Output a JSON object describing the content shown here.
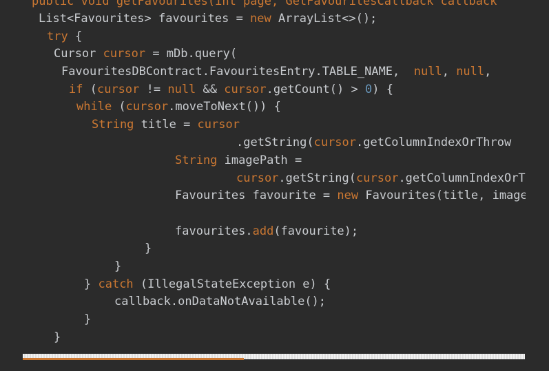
{
  "editor": {
    "lines": [
      [
        {
          "t": "public void getFavourites(int page, GetFavouritesCallback callback",
          "c": "partial"
        }
      ],
      [
        {
          "t": "List<Favourites> favourites = ",
          "c": "tok-plain"
        },
        {
          "t": "new",
          "c": "tok-kw"
        },
        {
          "t": " ArrayList<>();",
          "c": "tok-plain"
        }
      ],
      [
        {
          "t": "try",
          "c": "tok-kw"
        },
        {
          "t": " {",
          "c": "tok-plain"
        }
      ],
      [
        {
          "t": "Cursor ",
          "c": "tok-plain"
        },
        {
          "t": "cursor",
          "c": "tok-orange"
        },
        {
          "t": " = mDb.query(",
          "c": "tok-plain"
        }
      ],
      [
        {
          "t": "FavouritesDBContract.FavouritesEntry.TABLE_NAME,  ",
          "c": "tok-plain"
        },
        {
          "t": "null",
          "c": "tok-kw"
        },
        {
          "t": ", ",
          "c": "tok-plain"
        },
        {
          "t": "null",
          "c": "tok-kw"
        },
        {
          "t": ",",
          "c": "tok-plain"
        }
      ],
      [
        {
          "t": "if",
          "c": "tok-kw"
        },
        {
          "t": " (",
          "c": "tok-plain"
        },
        {
          "t": "cursor",
          "c": "tok-orange"
        },
        {
          "t": " != ",
          "c": "tok-plain"
        },
        {
          "t": "null",
          "c": "tok-kw"
        },
        {
          "t": " && ",
          "c": "tok-plain"
        },
        {
          "t": "cursor",
          "c": "tok-orange"
        },
        {
          "t": ".getCount() > ",
          "c": "tok-plain"
        },
        {
          "t": "0",
          "c": "tok-num"
        },
        {
          "t": ") {",
          "c": "tok-plain"
        }
      ],
      [
        {
          "t": "while",
          "c": "tok-kw"
        },
        {
          "t": " (",
          "c": "tok-plain"
        },
        {
          "t": "cursor",
          "c": "tok-orange"
        },
        {
          "t": ".moveToNext()) {",
          "c": "tok-plain"
        }
      ],
      [
        {
          "t": "String",
          "c": "tok-kw"
        },
        {
          "t": " title = ",
          "c": "tok-plain"
        },
        {
          "t": "cursor",
          "c": "tok-orange"
        }
      ],
      [
        {
          "t": ".getString(",
          "c": "tok-plain"
        },
        {
          "t": "cursor",
          "c": "tok-orange"
        },
        {
          "t": ".getColumnIndexOrThrow",
          "c": "tok-plain"
        }
      ],
      [
        {
          "t": "String",
          "c": "tok-kw"
        },
        {
          "t": " imagePath =",
          "c": "tok-plain"
        }
      ],
      [
        {
          "t": "cursor",
          "c": "tok-orange"
        },
        {
          "t": ".getString(",
          "c": "tok-plain"
        },
        {
          "t": "cursor",
          "c": "tok-orange"
        },
        {
          "t": ".getColumnIndexOrThrow",
          "c": "tok-plain"
        }
      ],
      [
        {
          "t": "Favourites favourite = ",
          "c": "tok-plain"
        },
        {
          "t": "new",
          "c": "tok-kw"
        },
        {
          "t": " Favourites(title, imagePath",
          "c": "tok-plain"
        }
      ],
      [
        {
          "t": "",
          "c": "tok-plain"
        }
      ],
      [
        {
          "t": "favourites.",
          "c": "tok-plain"
        },
        {
          "t": "add",
          "c": "tok-orange"
        },
        {
          "t": "(favourite);",
          "c": "tok-plain"
        }
      ],
      [
        {
          "t": "}",
          "c": "tok-plain"
        }
      ],
      [
        {
          "t": "}",
          "c": "tok-plain"
        }
      ],
      [
        {
          "t": "} ",
          "c": "tok-plain"
        },
        {
          "t": "catch",
          "c": "tok-kw"
        },
        {
          "t": " (IllegalStateException e) {",
          "c": "tok-plain"
        }
      ],
      [
        {
          "t": "callback.onDataNotAvailable();",
          "c": "tok-plain"
        }
      ],
      [
        {
          "t": "}",
          "c": "tok-plain"
        }
      ],
      [
        {
          "t": "}",
          "c": "tok-plain"
        }
      ]
    ]
  },
  "scrollbar": {
    "thumb_fraction": 0.44
  }
}
